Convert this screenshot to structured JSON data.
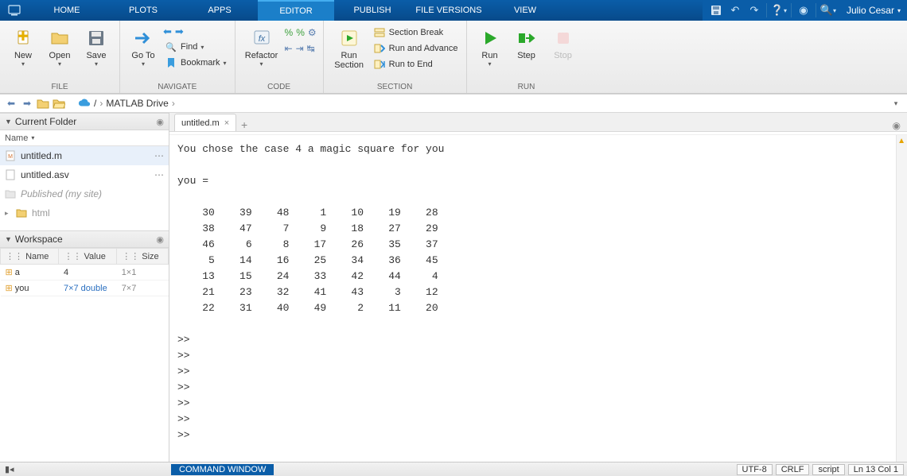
{
  "top_tabs": [
    "HOME",
    "PLOTS",
    "APPS",
    "EDITOR",
    "PUBLISH",
    "FILE VERSIONS",
    "VIEW"
  ],
  "active_tab_index": 3,
  "user": "Julio Cesar",
  "ribbon": {
    "file": {
      "label": "FILE",
      "new": "New",
      "open": "Open",
      "save": "Save"
    },
    "navigate": {
      "label": "NAVIGATE",
      "goto": "Go To",
      "find": "Find",
      "bookmark": "Bookmark"
    },
    "code": {
      "label": "CODE",
      "refactor": "Refactor"
    },
    "section": {
      "label": "SECTION",
      "run_section": "Run\nSection",
      "section_break": "Section Break",
      "run_advance": "Run and Advance",
      "run_to_end": "Run to End"
    },
    "run": {
      "label": "RUN",
      "run": "Run",
      "step": "Step",
      "stop": "Stop"
    }
  },
  "path": {
    "root": "MATLAB Drive"
  },
  "current_folder": {
    "title": "Current Folder",
    "header": "Name",
    "items": [
      {
        "name": "untitled.m",
        "type": "m",
        "has_menu": true,
        "selected": true
      },
      {
        "name": "untitled.asv",
        "type": "asv",
        "has_menu": true
      },
      {
        "name": "Published (my site)",
        "type": "folder-gray"
      },
      {
        "name": "html",
        "type": "folder",
        "expandable": true
      }
    ]
  },
  "workspace": {
    "title": "Workspace",
    "columns": [
      "Name",
      "Value",
      "Size"
    ],
    "rows": [
      {
        "name": "a",
        "value": "4",
        "size": "1×1"
      },
      {
        "name": "you",
        "value": "7×7 double",
        "size": "7×7",
        "link": true
      }
    ]
  },
  "editor": {
    "open_file": "untitled.m",
    "content": "You chose the case 4 a magic square for you\n\nyou =\n\n    30    39    48     1    10    19    28\n    38    47     7     9    18    27    29\n    46     6     8    17    26    35    37\n     5    14    16    25    34    36    45\n    13    15    24    33    42    44     4\n    21    23    32    41    43     3    12\n    22    31    40    49     2    11    20\n\n>> \n>> \n>> \n>> \n>> \n>> \n>> "
  },
  "statusbar": {
    "command_window": "COMMAND WINDOW",
    "encoding": "UTF-8",
    "eol": "CRLF",
    "type": "script",
    "position": "Ln  13  Col  1"
  }
}
